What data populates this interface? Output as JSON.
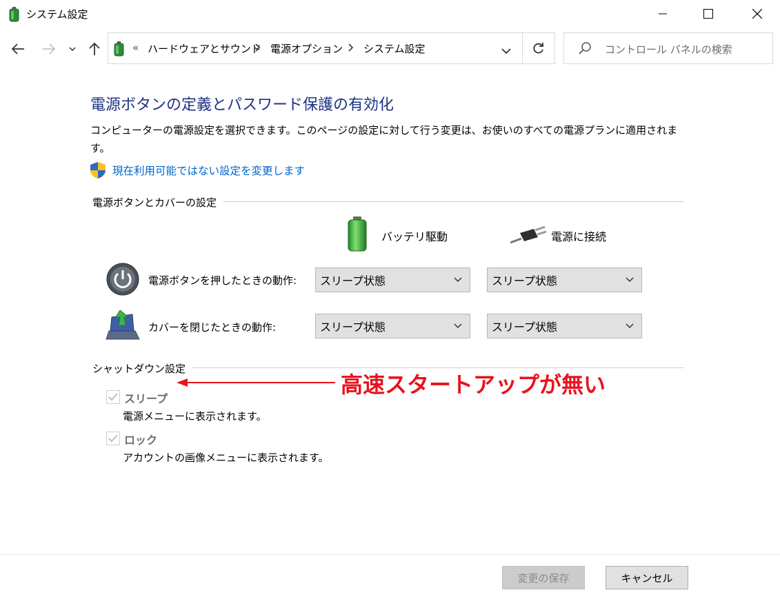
{
  "window": {
    "title": "システム設定"
  },
  "address": {
    "overflow": "«",
    "crumbs": [
      "ハードウェアとサウンド",
      "電源オプション",
      "システム設定"
    ]
  },
  "search": {
    "placeholder": "コントロール パネルの検索"
  },
  "page": {
    "heading": "電源ボタンの定義とパスワード保護の有効化",
    "description": "コンピューターの電源設定を選択できます。このページの設定に対して行う変更は、お使いのすべての電源プランに適用されます。",
    "change_link": "現在利用可能ではない設定を変更します"
  },
  "power_section": {
    "title": "電源ボタンとカバーの設定",
    "col_battery": "バッテリ駆動",
    "col_plugged": "電源に接続",
    "rows": [
      {
        "label": "電源ボタンを押したときの動作:",
        "battery": "スリープ状態",
        "plugged": "スリープ状態"
      },
      {
        "label": "カバーを閉じたときの動作:",
        "battery": "スリープ状態",
        "plugged": "スリープ状態"
      }
    ]
  },
  "shutdown_section": {
    "title": "シャットダウン設定",
    "items": [
      {
        "label": "スリープ",
        "desc": "電源メニューに表示されます。",
        "checked": true,
        "disabled": true
      },
      {
        "label": "ロック",
        "desc": "アカウントの画像メニューに表示されます。",
        "checked": true,
        "disabled": true
      }
    ]
  },
  "annotation": {
    "text": "高速スタートアップが無い",
    "color": "#e8131d"
  },
  "buttons": {
    "save": "変更の保存",
    "cancel": "キャンセル"
  },
  "colors": {
    "heading": "#1e3287",
    "link": "#0066cc"
  }
}
